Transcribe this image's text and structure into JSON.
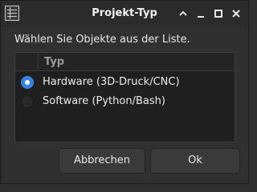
{
  "window": {
    "title": "Projekt-Typ"
  },
  "titlebar_buttons": [
    "chevron-up-icon",
    "minimize-icon",
    "maximize-icon",
    "close-icon"
  ],
  "prompt": "Wählen Sie Objekte aus der Liste.",
  "list": {
    "column_header": "Typ",
    "options": [
      {
        "label": "Hardware (3D-Druck/CNC)",
        "selected": true
      },
      {
        "label": "Software (Python/Bash)",
        "selected": false
      }
    ]
  },
  "buttons": {
    "cancel": "Abbrechen",
    "ok": "Ok"
  },
  "colors": {
    "accent": "#3584e4",
    "window_bg": "#303030",
    "list_bg": "#1f1f1f"
  }
}
